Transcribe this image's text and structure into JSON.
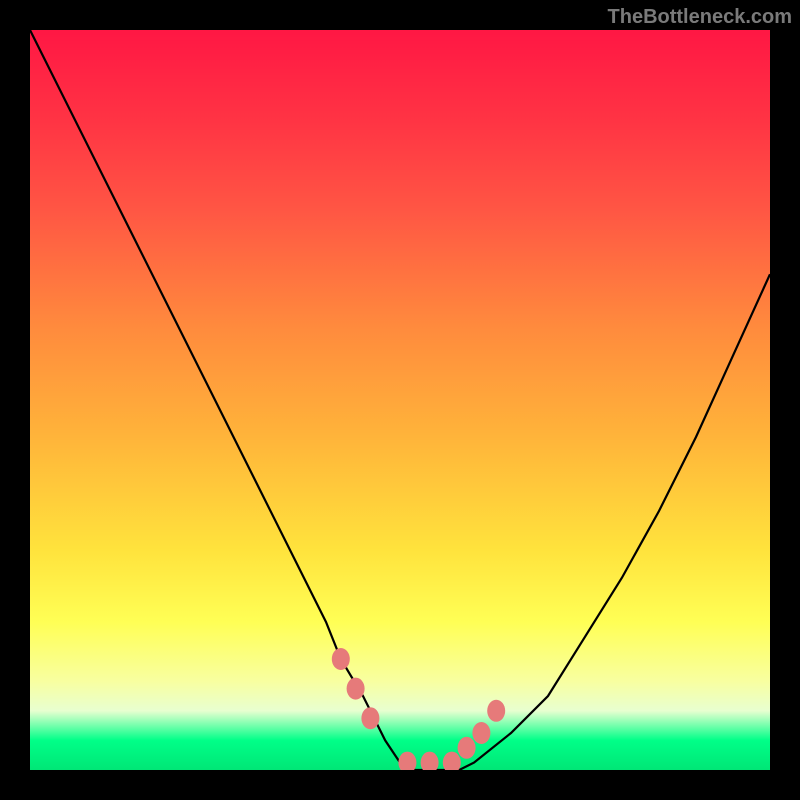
{
  "watermark": "TheBottleneck.com",
  "chart_data": {
    "type": "line",
    "title": "",
    "xlabel": "",
    "ylabel": "",
    "x_range": [
      0,
      100
    ],
    "y_range": [
      0,
      100
    ],
    "series": [
      {
        "name": "bottleneck-curve",
        "x": [
          0,
          5,
          10,
          15,
          20,
          25,
          30,
          35,
          40,
          42,
          45,
          48,
          50,
          52,
          55,
          58,
          60,
          65,
          70,
          75,
          80,
          85,
          90,
          95,
          100
        ],
        "y": [
          100,
          90,
          80,
          70,
          60,
          50,
          40,
          30,
          20,
          15,
          10,
          4,
          1,
          0,
          0,
          0,
          1,
          5,
          10,
          18,
          26,
          35,
          45,
          56,
          67
        ]
      }
    ],
    "markers": {
      "name": "highlight-points",
      "x": [
        42,
        44,
        46,
        51,
        54,
        57,
        59,
        61,
        63
      ],
      "y": [
        15,
        11,
        7,
        1,
        1,
        1,
        3,
        5,
        8
      ]
    },
    "gradient_stops": [
      {
        "pos": 0.0,
        "color": "#ff1744"
      },
      {
        "pos": 0.4,
        "color": "#ff8a3d"
      },
      {
        "pos": 0.7,
        "color": "#ffe23c"
      },
      {
        "pos": 0.92,
        "color": "#e8ffd0"
      },
      {
        "pos": 1.0,
        "color": "#00e676"
      }
    ]
  }
}
